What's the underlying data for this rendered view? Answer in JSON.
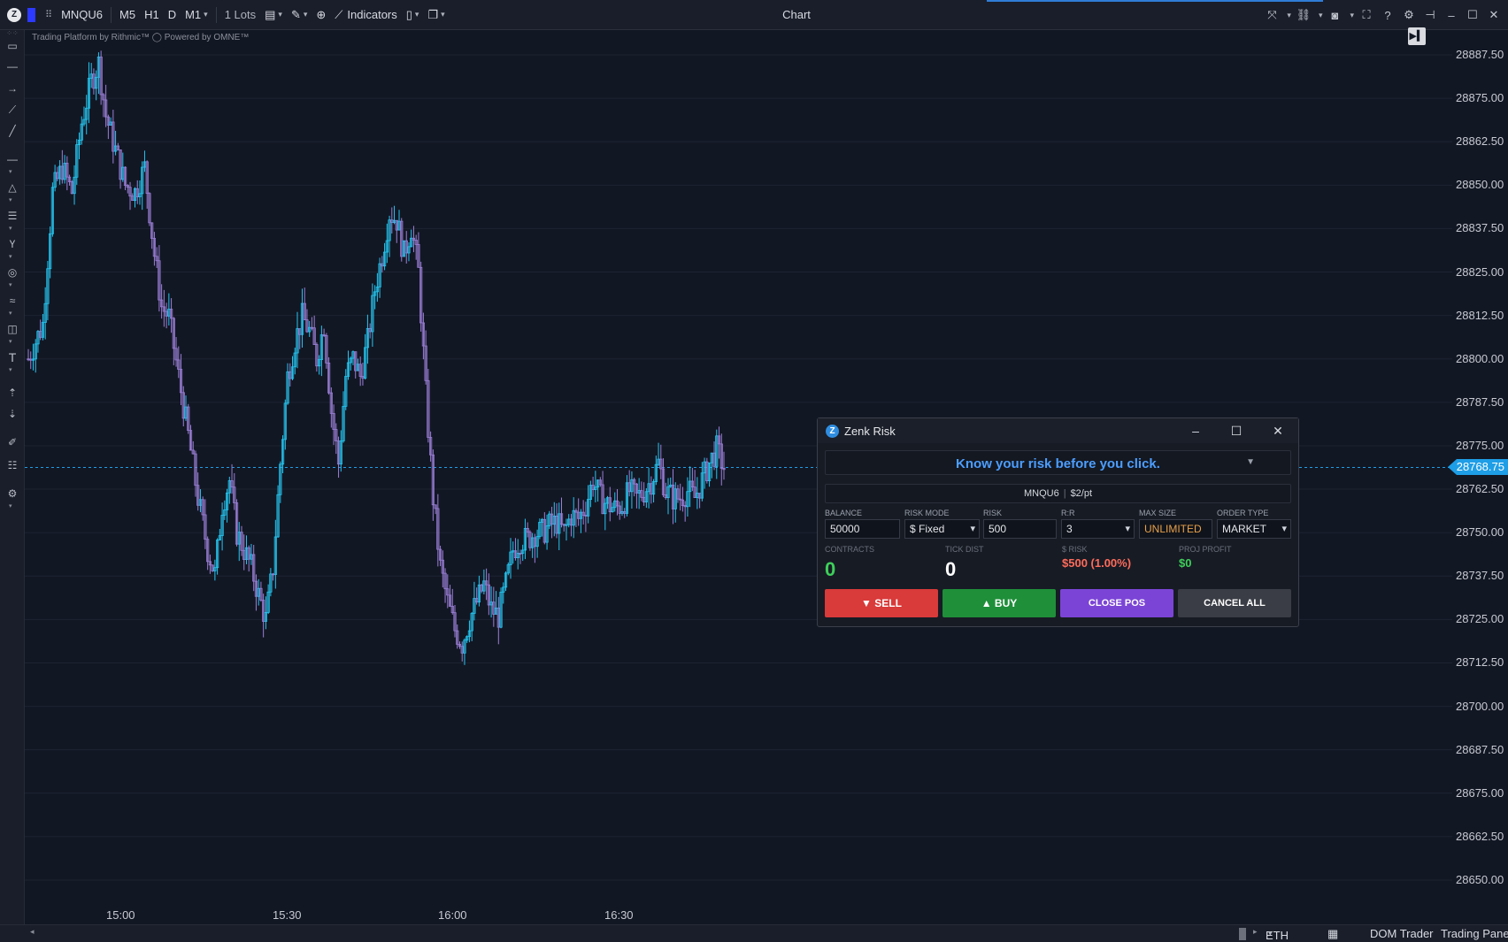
{
  "toolbar": {
    "symbol": "MNQU6",
    "timeframes": [
      "M5",
      "H1",
      "D",
      "M1"
    ],
    "lots": "1 Lots",
    "indicators_label": "Indicators",
    "title": "Chart"
  },
  "chart": {
    "watermark": "Trading Platform by Rithmic™  ◯ Powered by OMNE™",
    "price_levels": [
      "28887.50",
      "28875.00",
      "28862.50",
      "28850.00",
      "28837.50",
      "28825.00",
      "28812.50",
      "28800.00",
      "28787.50",
      "28775.00",
      "28762.50",
      "28750.00",
      "28737.50",
      "28725.00",
      "28712.50",
      "28700.00",
      "28687.50",
      "28675.00",
      "28662.50",
      "28650.00"
    ],
    "current_price": "28768.75",
    "time_labels": [
      "15:00",
      "15:30",
      "16:00",
      "16:30"
    ],
    "colors": {
      "up": "#26c6f0",
      "down": "#9b7fd6",
      "background": "#121724",
      "price_line": "#1e9ee6"
    }
  },
  "chart_data": {
    "type": "candlestick",
    "symbol": "MNQU6",
    "ylim": [
      28643,
      28895
    ],
    "yticks": [
      28887.5,
      28875,
      28862.5,
      28850,
      28837.5,
      28825,
      28812.5,
      28800,
      28787.5,
      28775,
      28762.5,
      28750,
      28737.5,
      28725,
      28712.5,
      28700,
      28687.5,
      28675,
      28662.5,
      28650
    ],
    "xticks": [
      "15:00",
      "15:30",
      "16:00",
      "16:30"
    ],
    "last_price": 28768.75,
    "close_path": [
      [
        0,
        28800
      ],
      [
        6,
        28810
      ],
      [
        10,
        28848
      ],
      [
        14,
        28855
      ],
      [
        18,
        28848
      ],
      [
        22,
        28868
      ],
      [
        26,
        28880
      ],
      [
        29,
        28885
      ],
      [
        32,
        28870
      ],
      [
        36,
        28860
      ],
      [
        40,
        28850
      ],
      [
        44,
        28848
      ],
      [
        48,
        28855
      ],
      [
        52,
        28830
      ],
      [
        55,
        28815
      ],
      [
        58,
        28812
      ],
      [
        62,
        28795
      ],
      [
        66,
        28778
      ],
      [
        70,
        28760
      ],
      [
        74,
        28745
      ],
      [
        77,
        28738
      ],
      [
        80,
        28758
      ],
      [
        83,
        28765
      ],
      [
        86,
        28750
      ],
      [
        89,
        28745
      ],
      [
        92,
        28740
      ],
      [
        95,
        28732
      ],
      [
        98,
        28725
      ],
      [
        101,
        28740
      ],
      [
        104,
        28770
      ],
      [
        107,
        28795
      ],
      [
        110,
        28805
      ],
      [
        113,
        28812
      ],
      [
        116,
        28808
      ],
      [
        119,
        28800
      ],
      [
        122,
        28810
      ],
      [
        125,
        28785
      ],
      [
        128,
        28770
      ],
      [
        131,
        28795
      ],
      [
        134,
        28800
      ],
      [
        137,
        28795
      ],
      [
        140,
        28805
      ],
      [
        143,
        28820
      ],
      [
        146,
        28830
      ],
      [
        149,
        28842
      ],
      [
        152,
        28840
      ],
      [
        155,
        28830
      ],
      [
        158,
        28838
      ],
      [
        161,
        28825
      ],
      [
        164,
        28790
      ],
      [
        167,
        28760
      ],
      [
        170,
        28740
      ],
      [
        173,
        28730
      ],
      [
        176,
        28722
      ],
      [
        179,
        28718
      ],
      [
        182,
        28725
      ],
      [
        185,
        28730
      ],
      [
        188,
        28735
      ],
      [
        191,
        28728
      ],
      [
        194,
        28726
      ],
      [
        197,
        28735
      ],
      [
        200,
        28745
      ],
      [
        203,
        28748
      ],
      [
        206,
        28748
      ],
      [
        209,
        28750
      ],
      [
        212,
        28750
      ],
      [
        215,
        28752
      ],
      [
        218,
        28753
      ],
      [
        221,
        28750
      ],
      [
        224,
        28755
      ],
      [
        227,
        28754
      ],
      [
        230,
        28758
      ],
      [
        233,
        28765
      ],
      [
        236,
        28760
      ],
      [
        239,
        28758
      ],
      [
        242,
        28757
      ],
      [
        245,
        28758
      ],
      [
        248,
        28762
      ],
      [
        251,
        28760
      ],
      [
        254,
        28762
      ],
      [
        257,
        28765
      ],
      [
        260,
        28770
      ],
      [
        263,
        28762
      ],
      [
        266,
        28760
      ],
      [
        269,
        28760
      ],
      [
        272,
        28762
      ],
      [
        275,
        28760
      ],
      [
        278,
        28765
      ],
      [
        281,
        28770
      ],
      [
        284,
        28774
      ],
      [
        287,
        28768.75
      ]
    ]
  },
  "bottombar": {
    "session": "ETH",
    "dom_trader": "DOM Trader",
    "trading_panel": "Trading Panel"
  },
  "risk_panel": {
    "title": "Zenk Risk",
    "tagline": "Know your risk before you click.",
    "symbol": "MNQU6",
    "point_value": "$2/pt",
    "fields": {
      "balance_label": "BALANCE",
      "balance": "50000",
      "risk_mode_label": "RISK MODE",
      "risk_mode": "$ Fixed",
      "risk_label": "RISK",
      "risk": "500",
      "rr_label": "R:R",
      "rr": "3",
      "max_size_label": "MAX SIZE",
      "max_size": "UNLIMITED",
      "order_type_label": "ORDER TYPE",
      "order_type": "MARKET"
    },
    "stats": {
      "contracts_label": "CONTRACTS",
      "contracts": "0",
      "tick_dist_label": "TICK DIST",
      "tick_dist": "0",
      "risk_label": "$ RISK",
      "risk_value": "$500 (1.00%)",
      "proj_profit_label": "PROJ PROFIT",
      "proj_profit": "$0"
    },
    "buttons": {
      "sell": "▼  SELL",
      "buy": "▲  BUY",
      "close": "CLOSE POS",
      "cancel": "CANCEL ALL"
    },
    "colors": {
      "sell": "#d93a3a",
      "buy": "#1f8f3a",
      "close": "#7b44d6",
      "cancel": "#3a3d45",
      "accent": "#4c9eff",
      "warn": "#e8a04a",
      "risk": "#ff6b5b",
      "profit": "#3ecf5a"
    }
  }
}
